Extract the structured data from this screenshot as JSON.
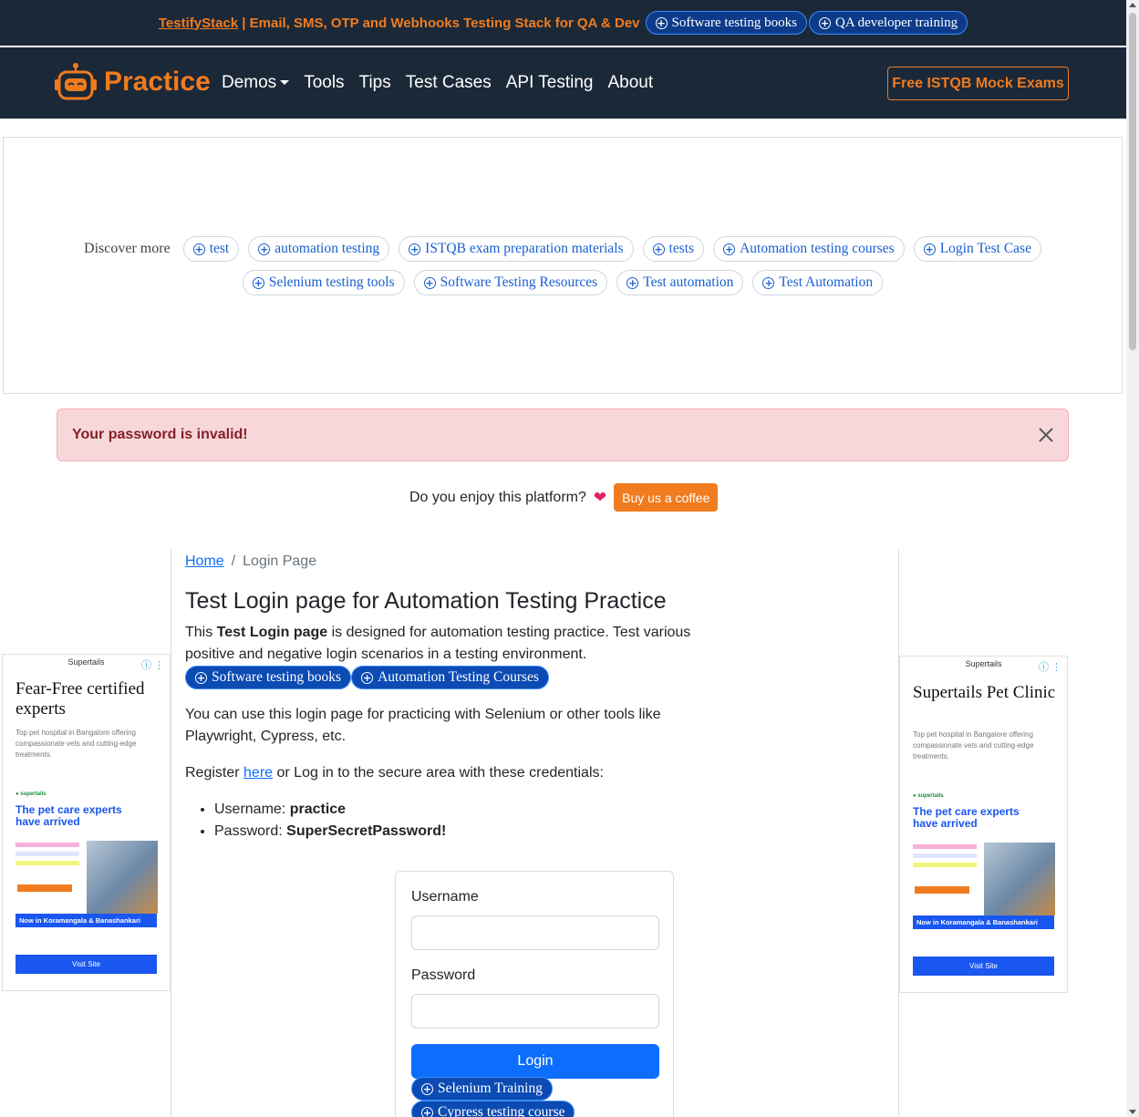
{
  "promo": {
    "brand_link": "TestifyStack",
    "text": " | Email, SMS, OTP and Webhooks Testing Stack for QA & Dev",
    "buttons": [
      "Software testing books",
      "QA developer training"
    ]
  },
  "navbar": {
    "brand": "Practice",
    "links": [
      "Demos",
      "Tools",
      "Tips",
      "Test Cases",
      "API Testing",
      "About"
    ],
    "cta": "Free ISTQB Mock Exams"
  },
  "discover": {
    "label": "Discover more",
    "row1": [
      "test",
      "automation testing",
      "ISTQB exam preparation materials",
      "tests",
      "Automation testing courses",
      "Login Test Case"
    ],
    "row2": [
      "Selenium testing tools",
      "Software Testing Resources",
      "Test automation",
      "Test Automation"
    ]
  },
  "alert": {
    "message": "Your password is invalid!"
  },
  "coffee": {
    "question": "Do you enjoy this platform?",
    "button": "Buy us a coffee"
  },
  "breadcrumb": {
    "home": "Home",
    "current": "Login Page"
  },
  "main": {
    "title": "Test Login page for Automation Testing Practice",
    "intro_prefix": "This ",
    "intro_bold": "Test Login page",
    "intro_suffix": " is designed for automation testing practice. Test various positive and negative login scenarios in a testing environment.",
    "pills": [
      "Software testing books",
      "Automation Testing Courses"
    ],
    "tools_text": "You can use this login page for practicing with Selenium or other tools like Playwright, Cypress, etc.",
    "register_prefix": "Register ",
    "register_link": "here",
    "register_suffix": " or Log in to the secure area with these credentials:",
    "username_label": "Username: ",
    "username_value": "practice",
    "password_label": "Password: ",
    "password_value": "SuperSecretPassword!"
  },
  "login_form": {
    "username_label": "Username",
    "password_label": "Password",
    "button": "Login",
    "pills": [
      "Selenium Training",
      "Cypress testing course"
    ]
  },
  "ads": {
    "left": {
      "brand": "Supertails",
      "title": "Fear-Free certified experts",
      "desc": "Top pet hospital in Bangalore offering compassionate vets and cutting-edge treatments.",
      "img_headline": "The pet care experts have arrived",
      "img_footer": "Now in Koramangala & Banashankari",
      "visit": "Visit Site"
    },
    "right": {
      "brand": "Supertails",
      "title": "Supertails Pet Clinic",
      "desc": "Top pet hospital in Bangalore offering compassionate vets and cutting-edge treatments.",
      "img_headline": "The pet care experts have arrived",
      "img_footer": "Now in Koramangala & Banashankari",
      "visit": "Visit Site"
    }
  },
  "colors": {
    "navy": "#1b2838",
    "orange": "#f07c1f",
    "primary": "#0d6efd",
    "danger_bg": "#f8d7da",
    "danger_text": "#842029"
  }
}
